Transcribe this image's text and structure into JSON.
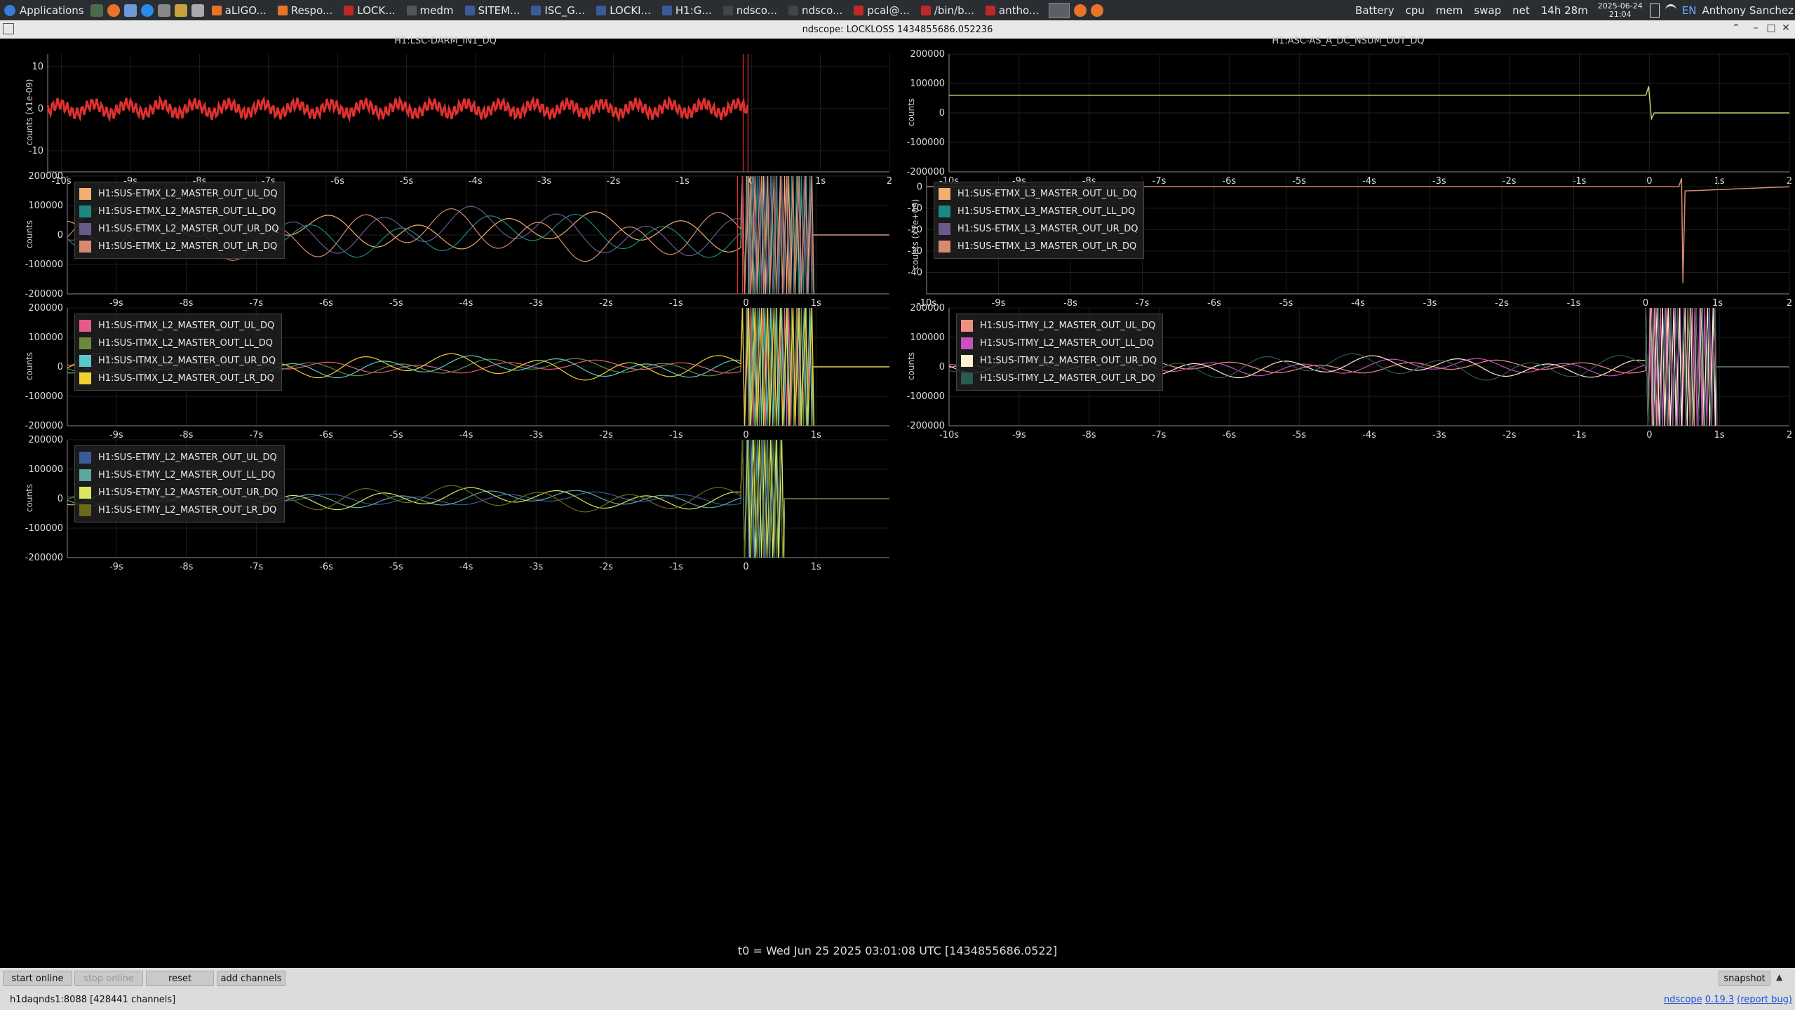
{
  "taskbar": {
    "applications_label": "Applications",
    "tasks": [
      "aLIGO...",
      "Respo...",
      "LOCK...",
      "medm",
      "SITEM...",
      "ISC_G...",
      "LOCKI...",
      "H1:G...",
      "ndsco...",
      "ndsco...",
      "pcal@...",
      "/bin/b...",
      "antho..."
    ],
    "tray": [
      "Battery",
      "cpu",
      "mem",
      "swap",
      "net",
      "14h 28m"
    ],
    "date": "2025-06-24",
    "time": "21:04",
    "lang": "EN",
    "user": "Anthony Sanchez"
  },
  "window": {
    "title": "ndscope: LOCKLOSS 1434855686.052236"
  },
  "colors": {
    "grid": "#1e1e1e",
    "axis": "#8a8a8a",
    "background": "#000000"
  },
  "plots": [
    {
      "id": "p00",
      "title": "H1:LSC-DARM_IN1_DQ",
      "ylabel": "counts (x1e-09)",
      "yticks": [
        "10",
        "0",
        "-10"
      ],
      "xticks": [
        "-10s",
        "-9s",
        "-8s",
        "-7s",
        "-6s",
        "-5s",
        "-4s",
        "-3s",
        "-2s",
        "-1s",
        "0",
        "1s",
        "2"
      ],
      "legend": []
    },
    {
      "id": "p01",
      "title": "H1:ASC-AS_A_DC_NSUM_OUT_DQ",
      "ylabel": "counts",
      "yticks": [
        "200000",
        "100000",
        "0",
        "-100000",
        "-200000"
      ],
      "xticks": [
        "-10s",
        "-9s",
        "-8s",
        "-7s",
        "-6s",
        "-5s",
        "-4s",
        "-3s",
        "-2s",
        "-1s",
        "0",
        "1s",
        "2"
      ],
      "legend": []
    },
    {
      "id": "p10",
      "title": "",
      "ylabel": "counts",
      "yticks": [
        "200000",
        "100000",
        "0",
        "-100000",
        "-200000"
      ],
      "xticks": [
        "-9s",
        "-8s",
        "-7s",
        "-6s",
        "-5s",
        "-4s",
        "-3s",
        "-2s",
        "-1s",
        "0",
        "1s"
      ],
      "legend": [
        {
          "label": "H1:SUS-ETMX_L2_MASTER_OUT_UL_DQ",
          "color": "#f0b070"
        },
        {
          "label": "H1:SUS-ETMX_L2_MASTER_OUT_LL_DQ",
          "color": "#1a8a80"
        },
        {
          "label": "H1:SUS-ETMX_L2_MASTER_OUT_UR_DQ",
          "color": "#6a5a8a"
        },
        {
          "label": "H1:SUS-ETMX_L2_MASTER_OUT_LR_DQ",
          "color": "#d88a70"
        }
      ]
    },
    {
      "id": "p11",
      "title": "",
      "ylabel": "counts (x1e+09)",
      "yticks": [
        "0",
        "-10",
        "-20",
        "-30",
        "-40"
      ],
      "xticks": [
        "-10s",
        "-9s",
        "-8s",
        "-7s",
        "-6s",
        "-5s",
        "-4s",
        "-3s",
        "-2s",
        "-1s",
        "0",
        "1s",
        "2"
      ],
      "legend": [
        {
          "label": "H1:SUS-ETMX_L3_MASTER_OUT_UL_DQ",
          "color": "#f0b070"
        },
        {
          "label": "H1:SUS-ETMX_L3_MASTER_OUT_LL_DQ",
          "color": "#1a8a80"
        },
        {
          "label": "H1:SUS-ETMX_L3_MASTER_OUT_UR_DQ",
          "color": "#6a5a8a"
        },
        {
          "label": "H1:SUS-ETMX_L3_MASTER_OUT_LR_DQ",
          "color": "#d88a70"
        }
      ]
    },
    {
      "id": "p20",
      "title": "",
      "ylabel": "counts",
      "yticks": [
        "200000",
        "100000",
        "0",
        "-100000",
        "-200000"
      ],
      "xticks": [
        "-9s",
        "-8s",
        "-7s",
        "-6s",
        "-5s",
        "-4s",
        "-3s",
        "-2s",
        "-1s",
        "0",
        "1s"
      ],
      "legend": [
        {
          "label": "H1:SUS-ITMX_L2_MASTER_OUT_UL_DQ",
          "color": "#e85a8a"
        },
        {
          "label": "H1:SUS-ITMX_L2_MASTER_OUT_LL_DQ",
          "color": "#6a8a3a"
        },
        {
          "label": "H1:SUS-ITMX_L2_MASTER_OUT_UR_DQ",
          "color": "#5ac8c8"
        },
        {
          "label": "H1:SUS-ITMX_L2_MASTER_OUT_LR_DQ",
          "color": "#f0d030"
        }
      ]
    },
    {
      "id": "p21",
      "title": "",
      "ylabel": "counts",
      "yticks": [
        "200000",
        "100000",
        "0",
        "-100000",
        "-200000"
      ],
      "xticks": [
        "-10s",
        "-9s",
        "-8s",
        "-7s",
        "-6s",
        "-5s",
        "-4s",
        "-3s",
        "-2s",
        "-1s",
        "0",
        "1s",
        "2"
      ],
      "legend": [
        {
          "label": "H1:SUS-ITMY_L2_MASTER_OUT_UL_DQ",
          "color": "#f09080"
        },
        {
          "label": "H1:SUS-ITMY_L2_MASTER_OUT_LL_DQ",
          "color": "#c850c0"
        },
        {
          "label": "H1:SUS-ITMY_L2_MASTER_OUT_UR_DQ",
          "color": "#fff0d0"
        },
        {
          "label": "H1:SUS-ITMY_L2_MASTER_OUT_LR_DQ",
          "color": "#2a5a50"
        }
      ]
    },
    {
      "id": "p30",
      "title": "",
      "ylabel": "counts",
      "yticks": [
        "200000",
        "100000",
        "0",
        "-100000",
        "-200000"
      ],
      "xticks": [
        "-9s",
        "-8s",
        "-7s",
        "-6s",
        "-5s",
        "-4s",
        "-3s",
        "-2s",
        "-1s",
        "0",
        "1s"
      ],
      "legend": [
        {
          "label": "H1:SUS-ETMY_L2_MASTER_OUT_UL_DQ",
          "color": "#3a5a9a"
        },
        {
          "label": "H1:SUS-ETMY_L2_MASTER_OUT_LL_DQ",
          "color": "#5aa8a0"
        },
        {
          "label": "H1:SUS-ETMY_L2_MASTER_OUT_UR_DQ",
          "color": "#d8e860"
        },
        {
          "label": "H1:SUS-ETMY_L2_MASTER_OUT_LR_DQ",
          "color": "#6a6a1a"
        }
      ]
    }
  ],
  "t0_text": "t0 = Wed Jun 25 2025 03:01:08 UTC [1434855686.0522]",
  "buttons": {
    "start_online": "start online",
    "stop_online": "stop online",
    "reset": "reset",
    "add_channels": "add channels",
    "snapshot": "snapshot"
  },
  "status": {
    "server": "h1daqnds1:8088  [428441 channels]",
    "link": "ndscope",
    "version": "0.19.3",
    "report": "(report bug)"
  }
}
